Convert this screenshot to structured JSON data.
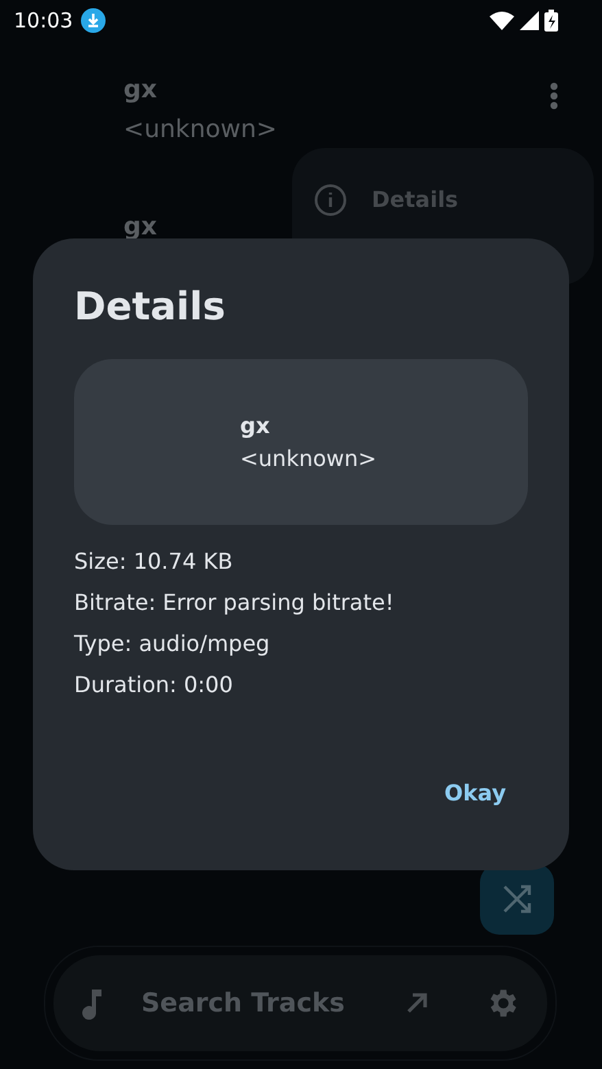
{
  "status_bar": {
    "time": "10:03"
  },
  "tracks": [
    {
      "title": "gx",
      "artist": "<unknown>"
    },
    {
      "title": "gx"
    }
  ],
  "context_menu": {
    "items": [
      {
        "label": "Details"
      }
    ]
  },
  "dialog": {
    "title": "Details",
    "track": {
      "title": "gx",
      "artist": "<unknown>"
    },
    "info": [
      "Size: 10.74 KB",
      "Bitrate: Error parsing bitrate!",
      "Type: audio/mpeg",
      "Duration: 0:00"
    ],
    "button": "Okay"
  },
  "search": {
    "placeholder": "Search Tracks"
  }
}
